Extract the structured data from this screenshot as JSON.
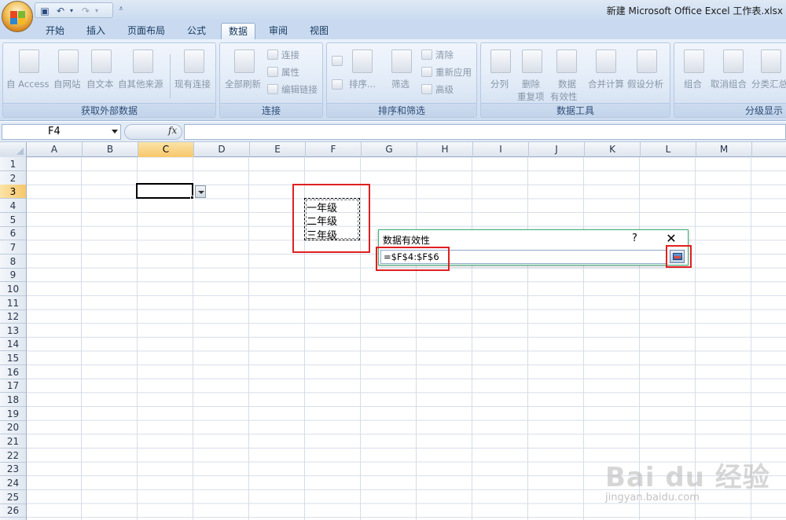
{
  "window": {
    "title": "新建 Microsoft Office Excel 工作表.xlsx"
  },
  "tabs": [
    {
      "label": "开始"
    },
    {
      "label": "插入"
    },
    {
      "label": "页面布局"
    },
    {
      "label": "公式"
    },
    {
      "label": "数据",
      "active": true
    },
    {
      "label": "审阅"
    },
    {
      "label": "视图"
    }
  ],
  "ribbon": {
    "get_external": {
      "label": "获取外部数据",
      "buttons": [
        "自 Access",
        "自网站",
        "自文本",
        "自其他来源",
        "现有连接"
      ]
    },
    "connections": {
      "label": "连接",
      "refresh_all": "全部刷新",
      "connections": "连接",
      "properties": "属性",
      "edit_links": "编辑链接"
    },
    "sort_filter": {
      "label": "排序和筛选",
      "sort": "排序...",
      "filter": "筛选",
      "clear": "清除",
      "reapply": "重新应用",
      "advanced": "高级"
    },
    "data_tools": {
      "label": "数据工具",
      "text_to_columns": "分列",
      "remove_dup_line1": "删除",
      "remove_dup_line2": "重复项",
      "validation_line1": "数据",
      "validation_line2": "有效性",
      "consolidate": "合并计算",
      "what_if": "假设分析"
    },
    "outline": {
      "label": "分级显示",
      "group": "组合",
      "ungroup": "取消组合",
      "subtotal": "分类汇总"
    }
  },
  "formula_bar": {
    "name_box": "F4",
    "fx": "fx",
    "value": ""
  },
  "columns": [
    "A",
    "B",
    "C",
    "D",
    "E",
    "F",
    "G",
    "H",
    "I",
    "J",
    "K",
    "L",
    "M"
  ],
  "rows": [
    "1",
    "2",
    "3",
    "4",
    "5",
    "6",
    "7",
    "8",
    "9",
    "10",
    "11",
    "12",
    "13",
    "14",
    "15",
    "16",
    "17",
    "18",
    "19",
    "20",
    "21",
    "22",
    "23",
    "24",
    "25",
    "26"
  ],
  "cells": {
    "F4": "一年级",
    "F5": "二年级",
    "F6": "三年级"
  },
  "dialog": {
    "title": "数据有效性",
    "help": "?",
    "close": "✕",
    "source_value": "=$F$4:$F$6"
  },
  "watermark": {
    "text": "Bai du 经验",
    "url": "jingyan.baidu.com"
  },
  "colors": {
    "highlight_red": "#e02020",
    "dialog_border": "#3fae7a",
    "selected_header": "#f6c76b"
  }
}
